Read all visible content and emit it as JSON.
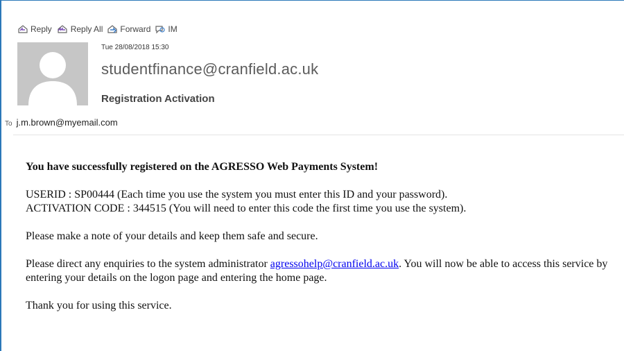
{
  "toolbar": {
    "items": [
      {
        "label": "Reply",
        "icon": "reply-icon"
      },
      {
        "label": "Reply All",
        "icon": "reply-all-icon"
      },
      {
        "label": "Forward",
        "icon": "forward-icon"
      },
      {
        "label": "IM",
        "icon": "im-icon"
      }
    ]
  },
  "header": {
    "date": "Tue 28/08/2018 15:30",
    "sender": "studentfinance@cranfield.ac.uk",
    "subject": "Registration Activation",
    "to_label": "To",
    "to": "j.m.brown@myemail.com"
  },
  "body": {
    "heading": "You have successfully registered on the AGRESSO Web Payments System!",
    "userid_line": "USERID : SP00444 (Each time you use the system you must enter this ID and your password).",
    "activation_line": "ACTIVATION CODE : 344515 (You will need to enter this code the first time you use the system).",
    "note": "Please make a note of your details and keep them safe and secure.",
    "enquiries_prefix": "Please direct any enquiries to the system administrator ",
    "enquiries_link": "agressohelp@cranfield.ac.uk",
    "enquiries_suffix": ". You will now be able to access this service by entering your details on the logon page and entering the home page.",
    "thanks": "Thank you for using this service."
  },
  "colors": {
    "accent": "#2b78b9",
    "link": "#0000ee",
    "avatar_bg": "#c6c6c6"
  }
}
